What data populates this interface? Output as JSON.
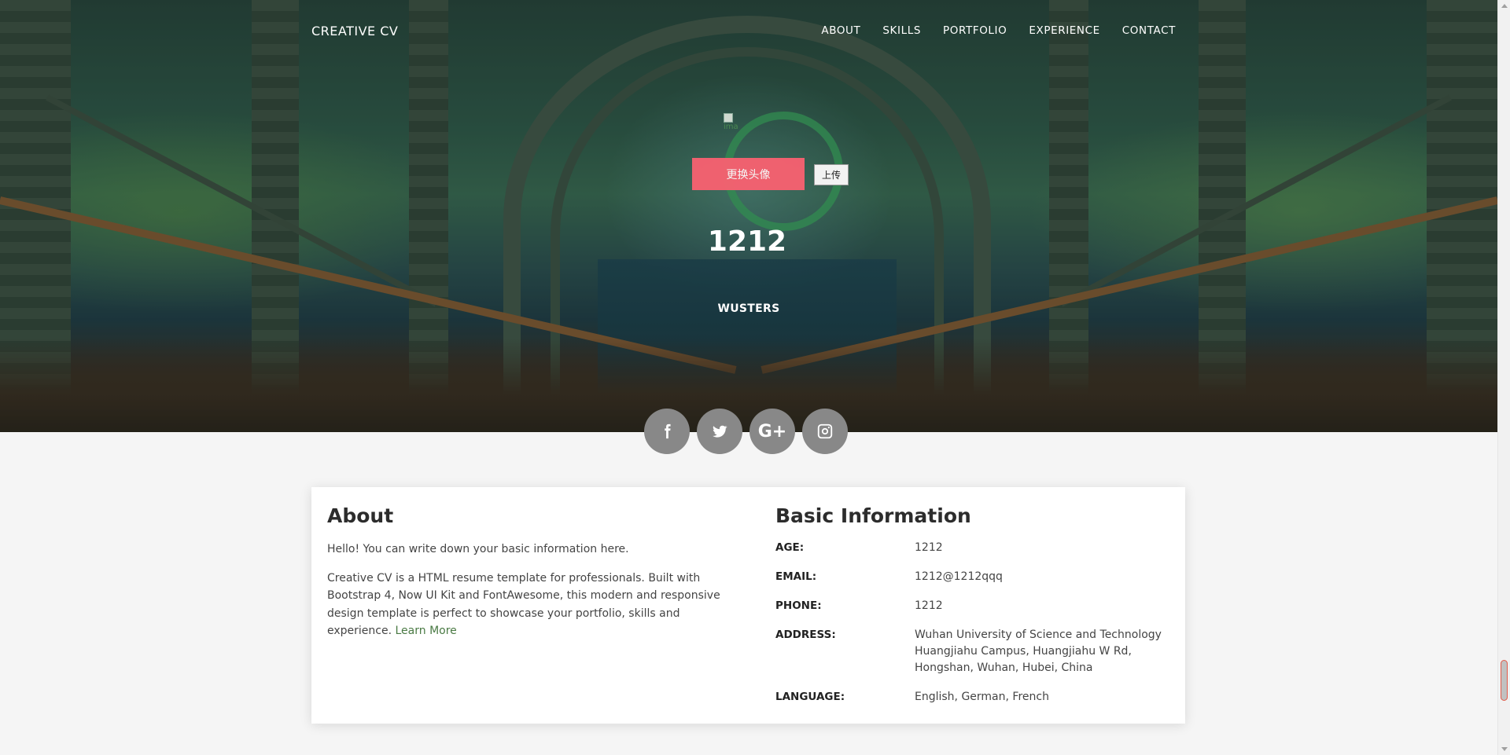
{
  "navbar": {
    "brand": "CREATIVE CV",
    "links": [
      "ABOUT",
      "SKILLS",
      "PORTFOLIO",
      "EXPERIENCE",
      "CONTACT"
    ]
  },
  "profile": {
    "avatar_alt": "ima",
    "change_avatar_label": "更换头像",
    "upload_label": "上传",
    "name": "1212",
    "title": "WUSTERS"
  },
  "social": {
    "icons": [
      "facebook-icon",
      "twitter-icon",
      "google-plus-icon",
      "instagram-icon"
    ],
    "google_plus_glyph": "G+"
  },
  "about": {
    "heading": "About",
    "intro": "Hello! You can write down your basic information here.",
    "body": "Creative CV is a HTML resume template for professionals. Built with Bootstrap 4, Now UI Kit and FontAwesome, this modern and responsive design template is perfect to showcase your portfolio, skills and experience.",
    "learn_more": "Learn More"
  },
  "basic_info": {
    "heading": "Basic Information",
    "rows": [
      {
        "label": "AGE:",
        "value": "1212"
      },
      {
        "label": "EMAIL:",
        "value": "1212@1212qqq"
      },
      {
        "label": "PHONE:",
        "value": "1212"
      },
      {
        "label": "ADDRESS:",
        "value": "Wuhan University of Science and Technology Huangjiahu Campus, Huangjiahu W Rd, Hongshan, Wuhan, Hubei, China"
      },
      {
        "label": "LANGUAGE:",
        "value": "English, German, French"
      }
    ]
  },
  "colors": {
    "accent_button": "#f96171",
    "social_button": "#888888",
    "link_green": "#4a7a44"
  }
}
